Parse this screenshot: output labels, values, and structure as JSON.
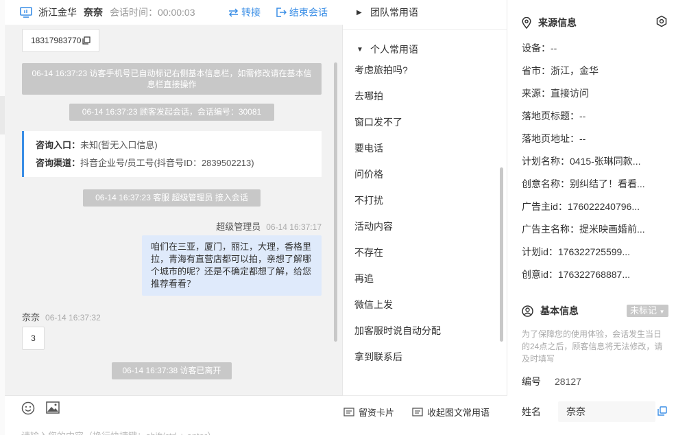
{
  "header": {
    "location": "浙江金华",
    "visitor_name": "奈奈",
    "timer_label": "会话时间：00:00:03",
    "transfer_label": "转接",
    "end_label": "结束会话"
  },
  "messages": {
    "phone_chip": "18317983770",
    "sys_phone_note": "06-14 16:37:23 访客手机号已自动标记右侧基本信息栏，如需修改请在基本信息栏直接操作",
    "sys_start": "06-14 16:37:23 顾客发起会话，会话编号：30081",
    "consult_entry_key": "咨询入口：",
    "consult_entry_val": "未知(暂无入口信息)",
    "consult_channel_key": "咨询渠道：",
    "consult_channel_val": "抖音企业号/员工号(抖音号ID：2839502213)",
    "sys_join": "06-14 16:37:23 客服 超级管理员 接入会话",
    "agent_name": "超级管理员",
    "agent_time": "06-14 16:37:17",
    "agent_text": "咱们在三亚，厦门，丽江，大理，香格里拉，青海有直营店都可以拍，亲想了解哪个城市的呢？还是不确定都想了解，给您推荐看看？",
    "visitor_name": "奈奈",
    "visitor_time": "06-14 16:37:32",
    "visitor_text": "3",
    "sys_left": "06-14 16:37:38 访客已离开"
  },
  "compose": {
    "placeholder": "请输入您的内容（换行快捷键：shift/ctrl + enter）"
  },
  "quick_replies": {
    "team_group": "团队常用语",
    "personal_group": "个人常用语",
    "items": [
      "考虑旅拍吗?",
      "去哪拍",
      "窗口发不了",
      "要电话",
      "问价格",
      "不打扰",
      "活动内容",
      "不存在",
      "再追",
      "微信上发",
      "加客服时说自动分配",
      "拿到联系后"
    ],
    "card_label": "留资卡片",
    "collapse_label": "收起图文常用语"
  },
  "source_info": {
    "title": "来源信息",
    "rows": [
      "设备：--",
      "省市：浙江，金华",
      "来源：直接访问",
      "落地页标题：--",
      "落地页地址：--",
      "计划名称：0415-张琳同款...",
      "创意名称：别纠结了！看看...",
      "广告主id：176022240796...",
      "广告主名称：提米映画婚前...",
      "计划id：176322725599...",
      "创意id：176322768887..."
    ]
  },
  "basic_info": {
    "title": "基本信息",
    "badge": "未标记",
    "note": "为了保障您的使用体验，会话发生当日的24点之后，顾客信息将无法修改，请及时填写",
    "no_label": "编号",
    "no_value": "28127",
    "name_label": "姓名",
    "name_value": "奈奈"
  },
  "colors": {
    "accent": "#3a8ee6",
    "agent_bubble": "#dfeafb",
    "system_bg": "#c8c8c8"
  }
}
